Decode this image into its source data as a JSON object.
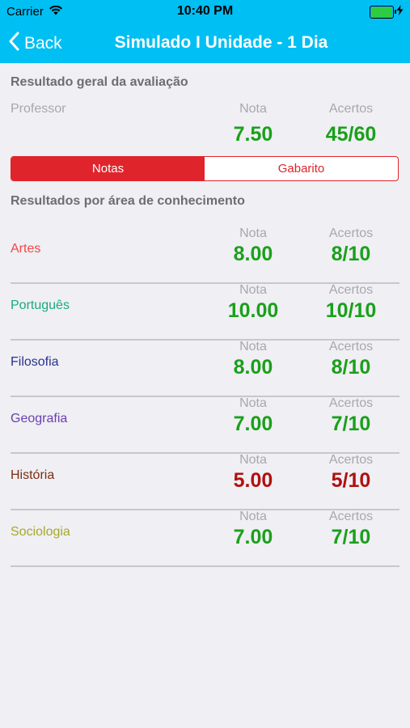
{
  "status": {
    "carrier": "Carrier",
    "time": "10:40 PM"
  },
  "nav": {
    "back_label": "Back",
    "title": "Simulado I Unidade - 1 Dia"
  },
  "general": {
    "section_title": "Resultado geral da avaliação",
    "professor_label": "Professor",
    "nota_label": "Nota",
    "acertos_label": "Acertos",
    "nota_value": "7.50",
    "acertos_value": "45/60",
    "value_color": "#1aa01a"
  },
  "segmented": {
    "tabs": [
      "Notas",
      "Gabarito"
    ],
    "selected": "Notas",
    "color": "#e0242b"
  },
  "areas": {
    "section_title": "Resultados por área de conhecimento",
    "nota_label": "Nota",
    "acertos_label": "Acertos",
    "rows": [
      {
        "subject": "Artes",
        "subject_color": "#f04848",
        "nota": "8.00",
        "acertos": "8/10",
        "value_color": "#1aa01a"
      },
      {
        "subject": "Português",
        "subject_color": "#1aab7a",
        "nota": "10.00",
        "acertos": "10/10",
        "value_color": "#1aa01a"
      },
      {
        "subject": "Filosofia",
        "subject_color": "#2a3190",
        "nota": "8.00",
        "acertos": "8/10",
        "value_color": "#1aa01a"
      },
      {
        "subject": "Geografia",
        "subject_color": "#6a3fb0",
        "nota": "7.00",
        "acertos": "7/10",
        "value_color": "#1aa01a"
      },
      {
        "subject": "História",
        "subject_color": "#7a2e10",
        "nota": "5.00",
        "acertos": "5/10",
        "value_color": "#b01010"
      },
      {
        "subject": "Sociologia",
        "subject_color": "#a8a82a",
        "nota": "7.00",
        "acertos": "7/10",
        "value_color": "#1aa01a"
      }
    ]
  }
}
